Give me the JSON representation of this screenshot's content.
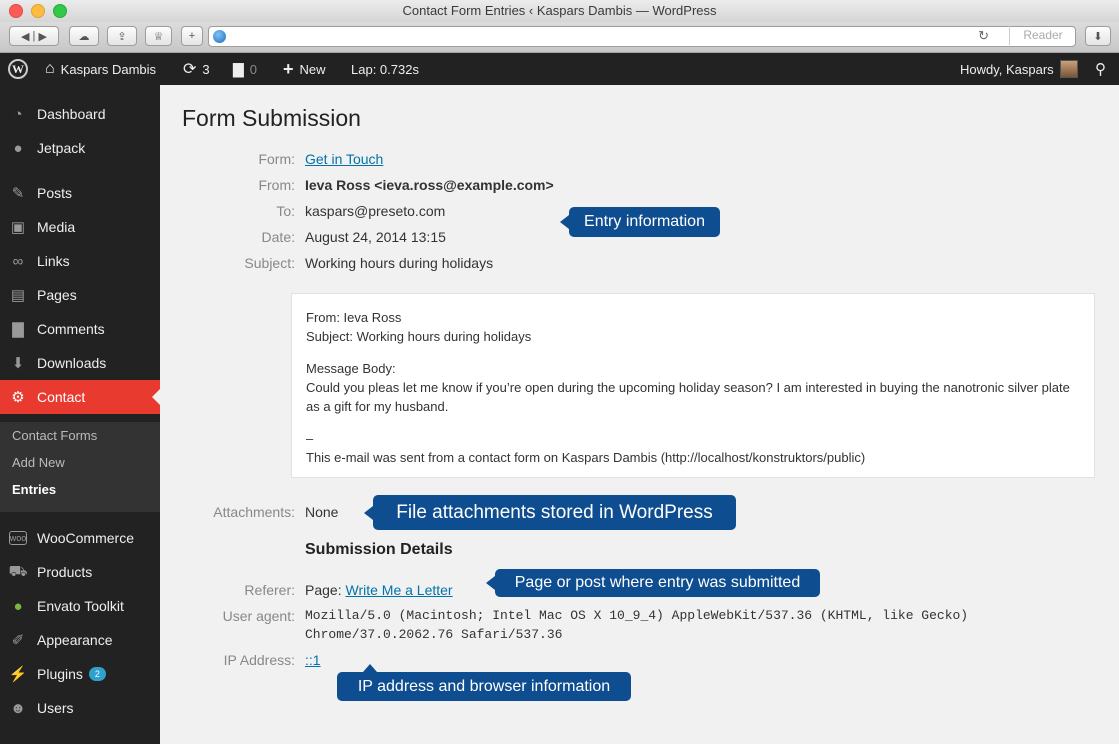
{
  "window": {
    "title": "Contact Form Entries ‹ Kaspars Dambis — WordPress",
    "reader_label": "Reader",
    "address_value": ""
  },
  "adminbar": {
    "site_name": "Kaspars Dambis",
    "updates_count": "3",
    "comments_count": "0",
    "new_label": "New",
    "lap_text": "Lap: 0.732s",
    "howdy_text": "Howdy, Kaspars"
  },
  "sidebar": {
    "items": [
      {
        "label": "Dashboard",
        "icon": "dashboard-icon"
      },
      {
        "label": "Jetpack",
        "icon": "jetpack-icon"
      },
      {
        "label": "Posts",
        "icon": "pin-icon"
      },
      {
        "label": "Media",
        "icon": "media-icon"
      },
      {
        "label": "Links",
        "icon": "link-icon"
      },
      {
        "label": "Pages",
        "icon": "pages-icon"
      },
      {
        "label": "Comments",
        "icon": "comment-icon"
      },
      {
        "label": "Downloads",
        "icon": "download-icon"
      },
      {
        "label": "Contact",
        "icon": "gear-icon"
      },
      {
        "label": "WooCommerce",
        "icon": "woo-icon"
      },
      {
        "label": "Products",
        "icon": "cart-icon"
      },
      {
        "label": "Envato Toolkit",
        "icon": "leaf-icon"
      },
      {
        "label": "Appearance",
        "icon": "brush-icon"
      },
      {
        "label": "Plugins",
        "icon": "plug-icon",
        "badge": "2"
      },
      {
        "label": "Users",
        "icon": "user-icon"
      }
    ],
    "submenu": [
      {
        "label": "Contact Forms"
      },
      {
        "label": "Add New"
      },
      {
        "label": "Entries"
      }
    ]
  },
  "main": {
    "title": "Form Submission",
    "fields": {
      "form_label": "Form:",
      "form_value": "Get in Touch",
      "from_label": "From:",
      "from_value": "Ieva Ross <ieva.ross@example.com>",
      "to_label": "To:",
      "to_value": "kaspars@preseto.com",
      "date_label": "Date:",
      "date_value": "August 24, 2014 13:15",
      "subject_label": "Subject:",
      "subject_value": "Working hours during holidays"
    },
    "message": {
      "from_line": "From: Ieva Ross",
      "subject_line": "Subject: Working hours during holidays",
      "body_heading": "Message Body:",
      "body_text": "Could you pleas let me know if you’re open during the upcoming holiday season? I am interested in buying the nanotronic silver plate as a gift for my husband.",
      "separator": "–",
      "footer": "This e-mail was sent from a contact form on Kaspars Dambis (http://localhost/konstruktors/public)"
    },
    "attachments_label": "Attachments:",
    "attachments_value": "None",
    "details_heading": "Submission Details",
    "referer_label": "Referer:",
    "referer_prefix": "Page:",
    "referer_link": "Write Me a Letter",
    "useragent_label": "User agent:",
    "useragent_line1": "Mozilla/5.0 (Macintosh; Intel Mac OS X 10_9_4) AppleWebKit/537.36 (KHTML, like Gecko)",
    "useragent_line2": "Chrome/37.0.2062.76 Safari/537.36",
    "ip_label": "IP Address:",
    "ip_value": "::1"
  },
  "callouts": {
    "entry": "Entry information",
    "attachments": "File attachments stored in WordPress",
    "page": "Page or post where entry was submitted",
    "ip": "IP address and browser information"
  },
  "colors": {
    "accent_active": "#e83a2f",
    "callout": "#0e4d8f",
    "link": "#0073aa",
    "admin_dark": "#222222"
  }
}
